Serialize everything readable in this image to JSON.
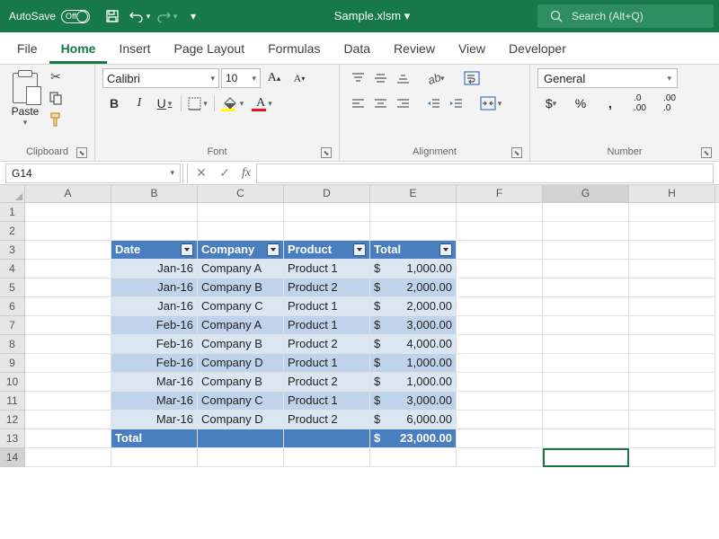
{
  "titlebar": {
    "autosave_label": "AutoSave",
    "autosave_state": "Off",
    "filename": "Sample.xlsm ▾",
    "search_placeholder": "Search (Alt+Q)"
  },
  "tabs": [
    "File",
    "Home",
    "Insert",
    "Page Layout",
    "Formulas",
    "Data",
    "Review",
    "View",
    "Developer"
  ],
  "active_tab": "Home",
  "ribbon": {
    "clipboard": {
      "label": "Clipboard",
      "paste": "Paste"
    },
    "font": {
      "label": "Font",
      "name": "Calibri",
      "size": "10",
      "bold": "B",
      "italic": "I",
      "underline": "U"
    },
    "alignment": {
      "label": "Alignment"
    },
    "number": {
      "label": "Number",
      "format": "General",
      "currency": "$",
      "percent": "%",
      "comma": ","
    }
  },
  "namebox": "G14",
  "columns": [
    "A",
    "B",
    "C",
    "D",
    "E",
    "F",
    "G",
    "H"
  ],
  "rows": [
    "1",
    "2",
    "3",
    "4",
    "5",
    "6",
    "7",
    "8",
    "9",
    "10",
    "11",
    "12",
    "13",
    "14"
  ],
  "selected_col": "G",
  "selected_row": "14",
  "table": {
    "headers": [
      "Date",
      "Company",
      "Product",
      "Total"
    ],
    "rows": [
      {
        "date": "Jan-16",
        "company": "Company A",
        "product": "Product 1",
        "total": "1,000.00"
      },
      {
        "date": "Jan-16",
        "company": "Company B",
        "product": "Product 2",
        "total": "2,000.00"
      },
      {
        "date": "Jan-16",
        "company": "Company C",
        "product": "Product 1",
        "total": "2,000.00"
      },
      {
        "date": "Feb-16",
        "company": "Company A",
        "product": "Product 1",
        "total": "3,000.00"
      },
      {
        "date": "Feb-16",
        "company": "Company B",
        "product": "Product 2",
        "total": "4,000.00"
      },
      {
        "date": "Feb-16",
        "company": "Company D",
        "product": "Product 1",
        "total": "1,000.00"
      },
      {
        "date": "Mar-16",
        "company": "Company B",
        "product": "Product 2",
        "total": "1,000.00"
      },
      {
        "date": "Mar-16",
        "company": "Company C",
        "product": "Product 1",
        "total": "3,000.00"
      },
      {
        "date": "Mar-16",
        "company": "Company D",
        "product": "Product 2",
        "total": "6,000.00"
      }
    ],
    "footer": {
      "label": "Total",
      "total": "23,000.00"
    }
  }
}
